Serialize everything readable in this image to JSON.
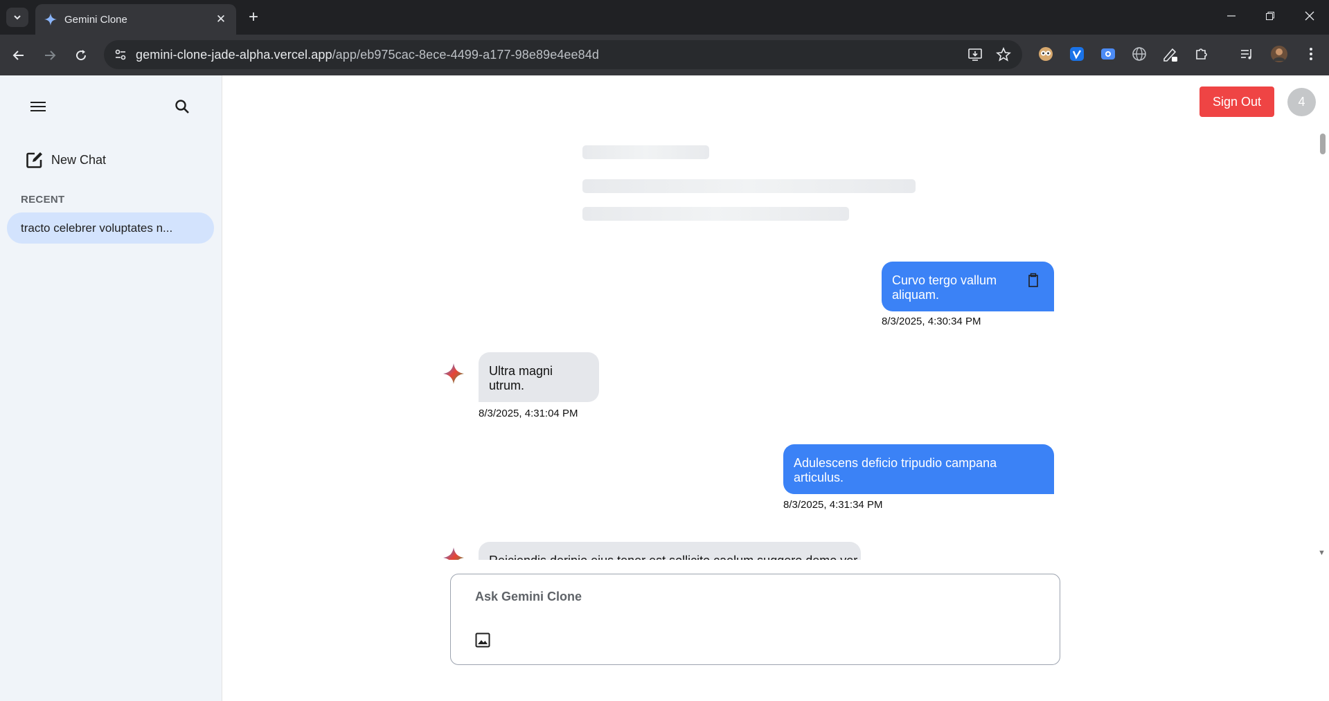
{
  "browser": {
    "tab_title": "Gemini Clone",
    "url_host": "gemini-clone-jade-alpha.vercel.app",
    "url_path": "/app/eb975cac-8ece-4499-a177-98e89e4ee84d"
  },
  "sidebar": {
    "new_chat_label": "New Chat",
    "recent_label": "RECENT",
    "recent_items": [
      {
        "label": "tracto celebrer voluptates n..."
      }
    ]
  },
  "header": {
    "sign_out_label": "Sign Out",
    "avatar_text": "4"
  },
  "messages": [
    {
      "role": "user",
      "text": "Curvo tergo vallum aliquam.",
      "timestamp": "8/3/2025, 4:30:34 PM"
    },
    {
      "role": "assistant",
      "text": "Ultra magni utrum.",
      "timestamp": "8/3/2025, 4:31:04 PM"
    },
    {
      "role": "user",
      "text": "Adulescens deficio tripudio campana articulus.",
      "timestamp": "8/3/2025, 4:31:34 PM"
    },
    {
      "role": "assistant",
      "text": "Reiciendis deripio eius tener est sollicito caelum suggero demo ver.",
      "timestamp": ""
    }
  ],
  "composer": {
    "placeholder": "Ask Gemini Clone"
  },
  "colors": {
    "user_bubble": "#3b82f6",
    "assistant_bubble": "#e5e7eb",
    "sign_out": "#ef4444",
    "sidebar_bg": "#f0f4f9",
    "active_recent": "#d3e3fd"
  }
}
